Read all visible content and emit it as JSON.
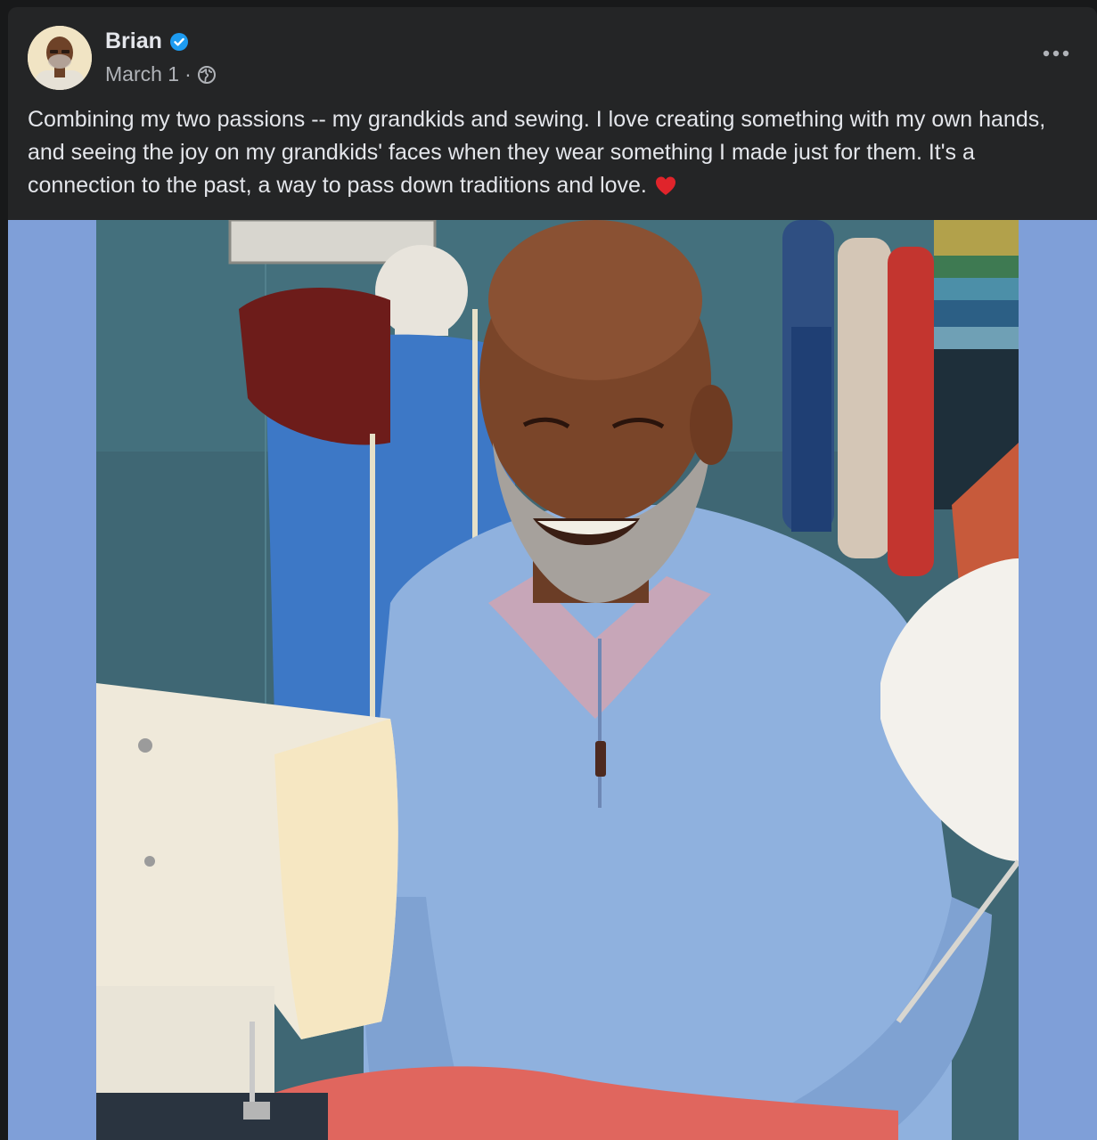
{
  "post": {
    "author": "Brian",
    "date": "March 1",
    "separator": "·",
    "text": "Combining my two passions -- my grandkids and sewing. I love creating something with my own hands, and seeing the joy on my grandkids' faces when they wear something I made just for them. It's a connection to the past, a way to pass down traditions and love.",
    "icons": {
      "verified": "verified-badge-icon",
      "audience": "globe-icon",
      "menu": "more-options-icon",
      "emoji": "red-heart-icon"
    },
    "colors": {
      "background": "#242526",
      "text": "#e4e6eb",
      "secondary_text": "#b0b3b8",
      "verified_blue": "#1d9bf0",
      "heart_red": "#e0242b",
      "photo_border": "#7f9fd8"
    }
  }
}
